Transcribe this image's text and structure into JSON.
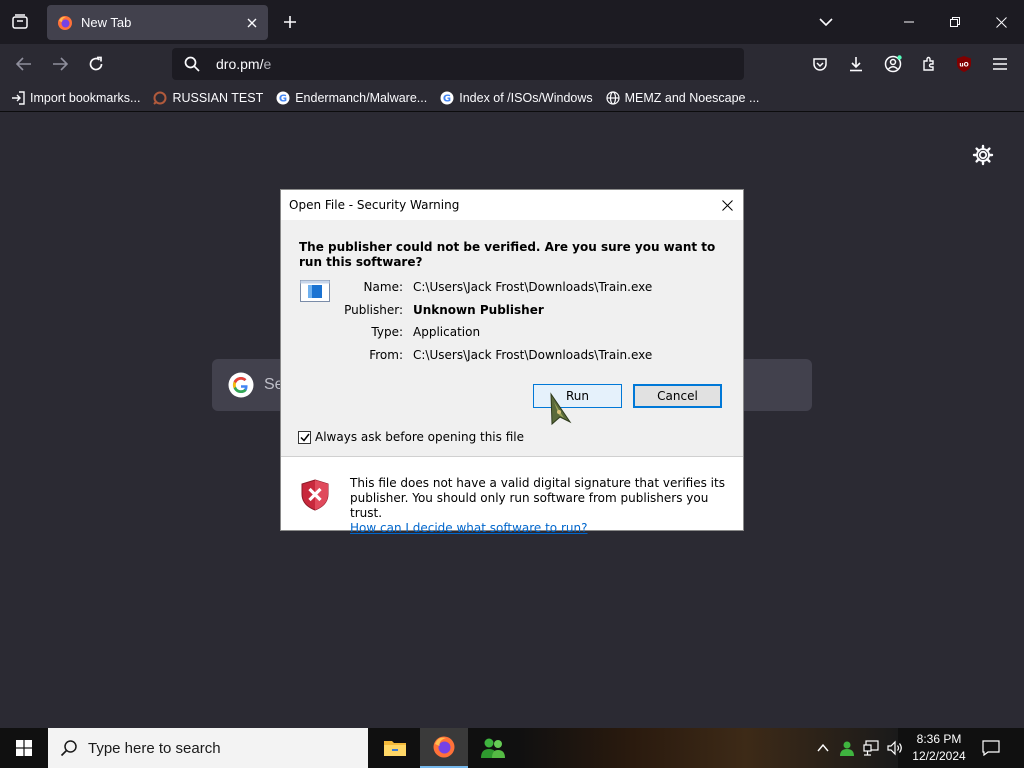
{
  "browser": {
    "tab": {
      "title": "New Tab"
    },
    "url": {
      "host": "dro.pm/",
      "path": "e"
    },
    "bookmarks": [
      {
        "label": "Import bookmarks...",
        "icon": "import-icon"
      },
      {
        "label": "RUSSIAN TEST",
        "icon": "russian-test-favicon"
      },
      {
        "label": "Endermanch/Malware...",
        "icon": "google-favicon"
      },
      {
        "label": "Index of /ISOs/Windows",
        "icon": "google-favicon"
      },
      {
        "label": "MEMZ and Noescape ...",
        "icon": "globe-icon"
      }
    ]
  },
  "page": {
    "search_placeholder": "Se"
  },
  "dialog": {
    "title": "Open File - Security Warning",
    "question": "The publisher could not be verified.  Are you sure you want to run this software?",
    "fields": {
      "name_label": "Name:",
      "name_value": "C:\\Users\\Jack Frost\\Downloads\\Train.exe",
      "publisher_label": "Publisher:",
      "publisher_value": "Unknown Publisher",
      "type_label": "Type:",
      "type_value": "Application",
      "from_label": "From:",
      "from_value": "C:\\Users\\Jack Frost\\Downloads\\Train.exe"
    },
    "run_label": "Run",
    "cancel_label": "Cancel",
    "checkbox_label": "Always ask before opening this file",
    "checkbox_checked": true,
    "warning_text": "This file does not have a valid digital signature that verifies its publisher.  You should only run software from publishers you trust.",
    "help_link": "How can I decide what software to run?"
  },
  "taskbar": {
    "search_placeholder": "Type here to search",
    "time": "8:36 PM",
    "date": "12/2/2024"
  },
  "colors": {
    "accent": "#0078d7",
    "browser_bg": "#2b2a33",
    "tabbar_bg": "#1c1b22",
    "link": "#0066cc"
  }
}
